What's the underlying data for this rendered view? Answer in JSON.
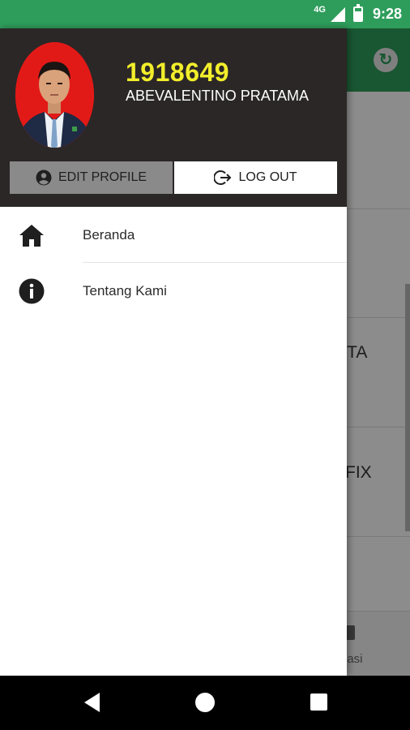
{
  "status_bar": {
    "network": "4G",
    "time": "9:28"
  },
  "background_app": {
    "refresh_icon": "refresh-icon",
    "item_1_text": "i TA",
    "item_2_text": "FIX",
    "bottom_nav_label": "nasi"
  },
  "profile": {
    "id": "1918649",
    "name": "ABEVALENTINO PRATAMA",
    "id_color": "#f2ee2b",
    "header_bg": "#2b2727"
  },
  "buttons": {
    "edit_profile": "EDIT PROFILE",
    "edit_profile_icon": "account-circle-icon",
    "logout": "LOG OUT",
    "logout_icon": "logout-icon"
  },
  "menu": [
    {
      "label": "Beranda",
      "icon": "home-icon"
    },
    {
      "label": "Tentang Kami",
      "icon": "info-icon"
    }
  ],
  "colors": {
    "brand_green": "#2e9d5b"
  }
}
